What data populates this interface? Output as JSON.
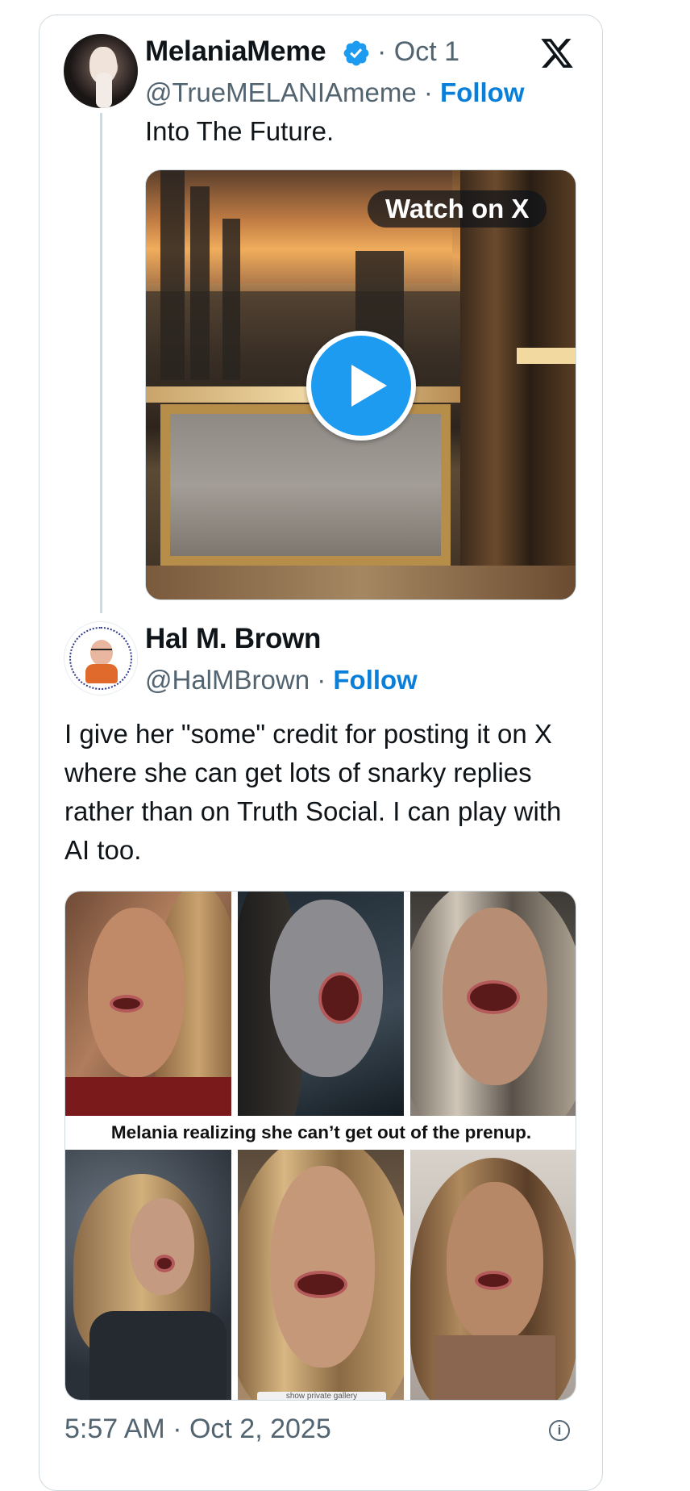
{
  "quoted_tweet": {
    "author_name": "MelaniaMeme",
    "verified": true,
    "date": "· Oct 1",
    "handle": "@TrueMELANIAmeme",
    "separator": " · ",
    "follow_label": "Follow",
    "text": "Into The Future.",
    "media": {
      "watch_label": "Watch on X"
    }
  },
  "reply_tweet": {
    "author_name": "Hal M. Brown",
    "handle": "@HalMBrown",
    "separator": " · ",
    "follow_label": "Follow",
    "text": "I give her \"some\" credit for posting it on X where she can get lots of snarky replies rather than on Truth Social. I can play with AI too.",
    "image_caption": "Melania realizing she can’t get out of the prenup.",
    "gallery_chip": "show private gallery"
  },
  "footer": {
    "timestamp": "5:57 AM · Oct 2, 2025"
  },
  "icons": {
    "brand": "x-logo-icon",
    "verified": "verified-badge-icon",
    "play": "play-icon",
    "info": "info-icon"
  },
  "colors": {
    "accent": "#1d9bf0",
    "follow": "#0a7fd9",
    "secondary_text": "#536471",
    "border": "#cfd9de"
  }
}
